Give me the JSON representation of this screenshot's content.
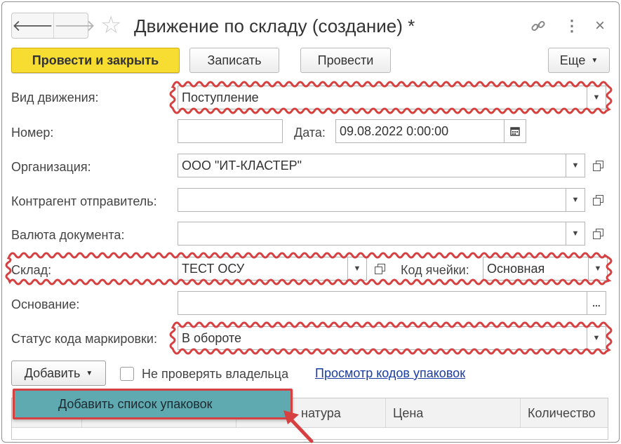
{
  "window": {
    "title": "Движение по складу (создание) *",
    "nav": {
      "back_glyph": "🡐",
      "forward_glyph": "🡒"
    },
    "icons": {
      "favorite": "star-icon",
      "link": "link-icon",
      "more": "more-icon",
      "close": "close-icon"
    },
    "link_glyph": "🔗",
    "more_glyph": "⋮",
    "close_glyph": "×",
    "star_glyph": "☆"
  },
  "toolbar": {
    "post_and_close": "Провести и закрыть",
    "save": "Записать",
    "post": "Провести",
    "more": "Еще"
  },
  "form": {
    "movement_type": {
      "label": "Вид движения:",
      "value": "Поступление"
    },
    "number": {
      "label": "Номер:",
      "value": ""
    },
    "date": {
      "label": "Дата:",
      "value": "09.08.2022  0:00:00"
    },
    "organization": {
      "label": "Организация:",
      "value": "ООО \"ИТ-КЛАСТЕР\""
    },
    "counterparty": {
      "label": "Контрагент отправитель:",
      "value": ""
    },
    "currency": {
      "label": "Валюта документа:",
      "value": ""
    },
    "warehouse": {
      "label": "Склад:",
      "value": "ТЕСТ ОСУ"
    },
    "cell_code": {
      "label": "Код ячейки:",
      "value": "Основная"
    },
    "basis": {
      "label": "Основание:",
      "value": ""
    },
    "marking_status": {
      "label": "Статус кода маркировки:",
      "value": "В обороте"
    }
  },
  "bottom": {
    "add_button": "Добавить",
    "dont_check_owner": "Не проверять владельца",
    "dont_check_owner_checked": false,
    "view_package_codes": "Просмотр кодов упаковок"
  },
  "table": {
    "columns": [
      "",
      "",
      "натура",
      "Цена",
      "Количество"
    ]
  },
  "popup_menu": {
    "add_package_list": "Добавить список упаковок"
  },
  "colors": {
    "primary_button": "#f7dd32",
    "highlight": "#d64040",
    "popup_background": "#5fa9b1",
    "link": "#1a3ca4"
  }
}
